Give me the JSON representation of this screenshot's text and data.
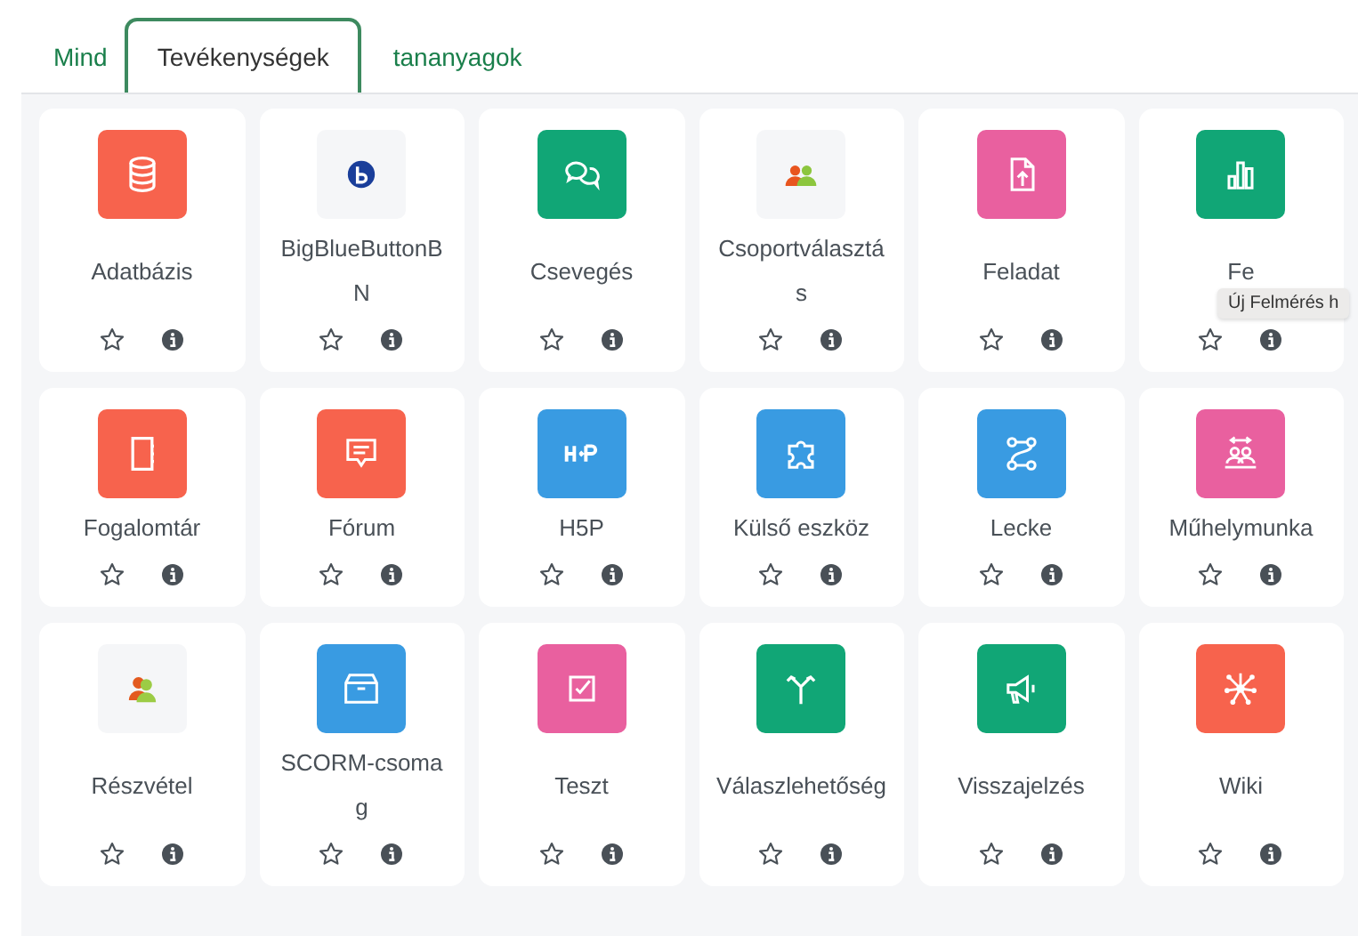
{
  "tabs": [
    {
      "label": "Mind",
      "selected": false
    },
    {
      "label": "Tevékenységek",
      "selected": true
    },
    {
      "label": "tananyagok",
      "selected": false
    }
  ],
  "activities": [
    {
      "name": "Adatbázis",
      "kind": "database",
      "color": "#f7634d",
      "starred": false
    },
    {
      "name": "BigBlueButtonBN",
      "kind": "bbb",
      "color": "#f5f6f8",
      "starred": false
    },
    {
      "name": "Csevegés",
      "kind": "chat",
      "color": "#11a676",
      "starred": false
    },
    {
      "name": "Csoportválasztás",
      "kind": "people",
      "color": "#f5f6f8",
      "starred": false
    },
    {
      "name": "Feladat",
      "kind": "upload",
      "color": "#e9609f",
      "starred": false
    },
    {
      "name": "Fe",
      "kind": "bars",
      "color": "#11a676",
      "starred": false
    },
    {
      "name": "Fogalomtár",
      "kind": "book",
      "color": "#f7634d",
      "starred": false
    },
    {
      "name": "Fórum",
      "kind": "forum",
      "color": "#f7634d",
      "starred": false
    },
    {
      "name": "H5P",
      "kind": "h5p",
      "color": "#399be2",
      "starred": false
    },
    {
      "name": "Külső eszköz",
      "kind": "puzzle",
      "color": "#399be2",
      "starred": false
    },
    {
      "name": "Lecke",
      "kind": "path",
      "color": "#399be2",
      "starred": false
    },
    {
      "name": "Műhelymunka",
      "kind": "workshop",
      "color": "#e9609f",
      "starred": false
    },
    {
      "name": "Részvétel",
      "kind": "attendance",
      "color": "#f5f6f8",
      "starred": false
    },
    {
      "name": "SCORM-csomag",
      "kind": "box",
      "color": "#399be2",
      "starred": false
    },
    {
      "name": "Teszt",
      "kind": "check",
      "color": "#e9609f",
      "starred": false
    },
    {
      "name": "Válaszlehetőség",
      "kind": "choice",
      "color": "#11a676",
      "starred": false
    },
    {
      "name": "Visszajelzés",
      "kind": "megaphone",
      "color": "#11a676",
      "starred": false
    },
    {
      "name": "Wiki",
      "kind": "network",
      "color": "#f7634d",
      "starred": false
    }
  ],
  "tooltip": {
    "text": "Új Felmérés h"
  }
}
